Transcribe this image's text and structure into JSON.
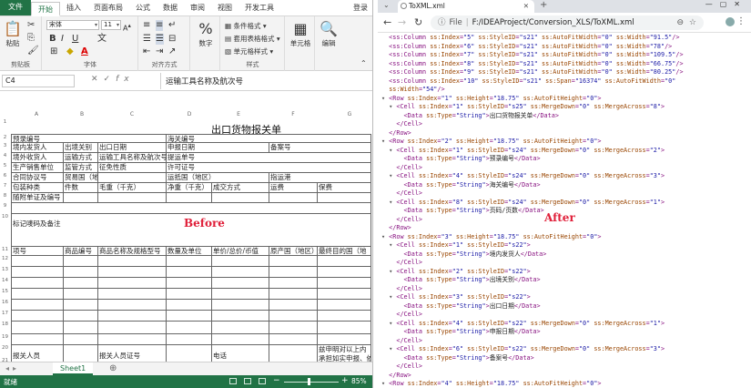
{
  "excel": {
    "menu": {
      "file": "文件",
      "tabs": [
        "开始",
        "插入",
        "页面布局",
        "公式",
        "数据",
        "审阅",
        "视图",
        "开发工具"
      ],
      "login": "登录"
    },
    "ribbon": {
      "paste": "粘贴",
      "clipboard": "剪贴板",
      "font_name": "宋体",
      "font_size": "11",
      "font": "字体",
      "alignment": "对齐方式",
      "number": "数字",
      "percent": "%",
      "cond_format": "条件格式",
      "table_format": "套用表格格式",
      "cell_style": "单元格样式",
      "styles": "样式",
      "cells": "单元格",
      "editing": "编辑",
      "bold": "B",
      "italic": "I",
      "underline": "U",
      "font_color": "A"
    },
    "namebox": "C4",
    "formula": "运输工具名称及航次号",
    "columns": [
      "A",
      "B",
      "C",
      "D",
      "E",
      "F",
      "G"
    ],
    "sheet_title": "出口货物报关单",
    "before_label": "Before",
    "cells": {
      "r3_a": "预录编号",
      "r3_d": "海关编号",
      "r4_a": "境内发货人",
      "r4_b": "出境关别",
      "r4_c": "出口日期",
      "r4_d": "申报日期",
      "r4_f": "备案号",
      "r5_a": "境外收货人",
      "r5_b": "运输方式",
      "r5_c": "运输工具名称及航次号",
      "r5_d": "提运单号",
      "r6_a": "生产销售单位",
      "r6_b": "监管方式",
      "r6_c": "征免性质",
      "r6_d": "许可证号",
      "r7_a": "合同协议号",
      "r7_b": "贸易国（地区）",
      "r7_d": "运抵国（地区）",
      "r7_f": "指运港",
      "r8_a": "包装种类",
      "r8_b": "件数",
      "r8_c": "毛重（千克）",
      "r8_d": "净重（千克）",
      "r8_e": "成交方式",
      "r8_f": "运费",
      "r8_g": "保费",
      "r9_a": "随附单证及编号",
      "r10_a": "标记唛码及备注",
      "r11_a": "项号",
      "r11_b": "商品编号",
      "r11_c": "商品名称及规格型号",
      "r11_d": "数量及单位",
      "r11_e": "单价/总价/币值",
      "r11_f": "原产国（地区）",
      "r11_g": "最终目的国（地",
      "r20_a": "报关人员",
      "r20_c": "报关人员证号",
      "r20_e": "电话",
      "r20_g": "兹申明对以上内",
      "r21_g": "承担如实申报、依",
      "r22_g": "纳税之法律责任"
    },
    "row_numbers": [
      "1",
      "2",
      "3",
      "4",
      "5",
      "6",
      "7",
      "8",
      "9",
      "10",
      "11",
      "12",
      "13",
      "14",
      "15",
      "16",
      "17",
      "18",
      "19",
      "20",
      "21",
      "22"
    ],
    "sheet_tab": "Sheet1",
    "status": "就绪",
    "zoom": "85%"
  },
  "browser": {
    "tab_title": "ToXML.xml",
    "address_label": "File",
    "address": "F:/IDEAProject/Conversion_XLS/ToXML.xml",
    "after_label": "After",
    "xml_lines": [
      {
        "t": "  <ss:Column ss:Index=\"5\" ss:StyleID=\"s21\" ss:AutoFitWidth=\"0\" ss:Width=\"91.5\"/>"
      },
      {
        "t": "  <ss:Column ss:Index=\"6\" ss:StyleID=\"s21\" ss:AutoFitWidth=\"0\" ss:Width=\"78\"/>"
      },
      {
        "t": "  <ss:Column ss:Index=\"7\" ss:StyleID=\"s21\" ss:AutoFitWidth=\"0\" ss:Width=\"109.5\"/>"
      },
      {
        "t": "  <ss:Column ss:Index=\"8\" ss:StyleID=\"s21\" ss:AutoFitWidth=\"0\" ss:Width=\"66.75\"/>"
      },
      {
        "t": "  <ss:Column ss:Index=\"9\" ss:StyleID=\"s21\" ss:AutoFitWidth=\"0\" ss:Width=\"80.25\"/>"
      },
      {
        "t": "  <ss:Column ss:Index=\"10\" ss:StyleID=\"s21\" ss:Span=\"16374\" ss:AutoFitWidth=\"0\""
      },
      {
        "t": "  ss:Width=\"54\"/>"
      },
      {
        "t": "▾ <Row ss:Index=\"1\" ss:Height=\"18.75\" ss:AutoFitHeight=\"0\">"
      },
      {
        "t": "  ▾ <Cell ss:Index=\"1\" ss:StyleID=\"s25\" ss:MergeDown=\"0\" ss:MergeAcross=\"8\">"
      },
      {
        "t": "      <Data ss:Type=\"String\">出口货物报关单</Data>"
      },
      {
        "t": "    </Cell>"
      },
      {
        "t": "  </Row>"
      },
      {
        "t": "▾ <Row ss:Index=\"2\" ss:Height=\"18.75\" ss:AutoFitHeight=\"0\">"
      },
      {
        "t": "  ▾ <Cell ss:Index=\"1\" ss:StyleID=\"s24\" ss:MergeDown=\"0\" ss:MergeAcross=\"2\">"
      },
      {
        "t": "      <Data ss:Type=\"String\">预录编号</Data>"
      },
      {
        "t": "    </Cell>"
      },
      {
        "t": "  ▾ <Cell ss:Index=\"4\" ss:StyleID=\"s24\" ss:MergeDown=\"0\" ss:MergeAcross=\"3\">"
      },
      {
        "t": "      <Data ss:Type=\"String\">海关编号</Data>"
      },
      {
        "t": "    </Cell>"
      },
      {
        "t": "  ▾ <Cell ss:Index=\"8\" ss:StyleID=\"s24\" ss:MergeDown=\"0\" ss:MergeAcross=\"1\">"
      },
      {
        "t": "      <Data ss:Type=\"String\">页码/页数</Data>"
      },
      {
        "t": "    </Cell>"
      },
      {
        "t": "  </Row>"
      },
      {
        "t": "▾ <Row ss:Index=\"3\" ss:Height=\"18.75\" ss:AutoFitHeight=\"0\">"
      },
      {
        "t": "  ▾ <Cell ss:Index=\"1\" ss:StyleID=\"s22\">"
      },
      {
        "t": "      <Data ss:Type=\"String\">境内发货人</Data>"
      },
      {
        "t": "    </Cell>"
      },
      {
        "t": "  ▾ <Cell ss:Index=\"2\" ss:StyleID=\"s22\">"
      },
      {
        "t": "      <Data ss:Type=\"String\">出境关别</Data>"
      },
      {
        "t": "    </Cell>"
      },
      {
        "t": "  ▾ <Cell ss:Index=\"3\" ss:StyleID=\"s22\">"
      },
      {
        "t": "      <Data ss:Type=\"String\">出口日期</Data>"
      },
      {
        "t": "    </Cell>"
      },
      {
        "t": "  ▾ <Cell ss:Index=\"4\" ss:StyleID=\"s22\" ss:MergeDown=\"0\" ss:MergeAcross=\"1\">"
      },
      {
        "t": "      <Data ss:Type=\"String\">申报日期</Data>"
      },
      {
        "t": "    </Cell>"
      },
      {
        "t": "  ▾ <Cell ss:Index=\"6\" ss:StyleID=\"s22\" ss:MergeDown=\"0\" ss:MergeAcross=\"3\">"
      },
      {
        "t": "      <Data ss:Type=\"String\">备案号</Data>"
      },
      {
        "t": "    </Cell>"
      },
      {
        "t": "  </Row>"
      },
      {
        "t": "▾ <Row ss:Index=\"4\" ss:Height=\"18.75\" ss:AutoFitHeight=\"0\">"
      }
    ]
  }
}
